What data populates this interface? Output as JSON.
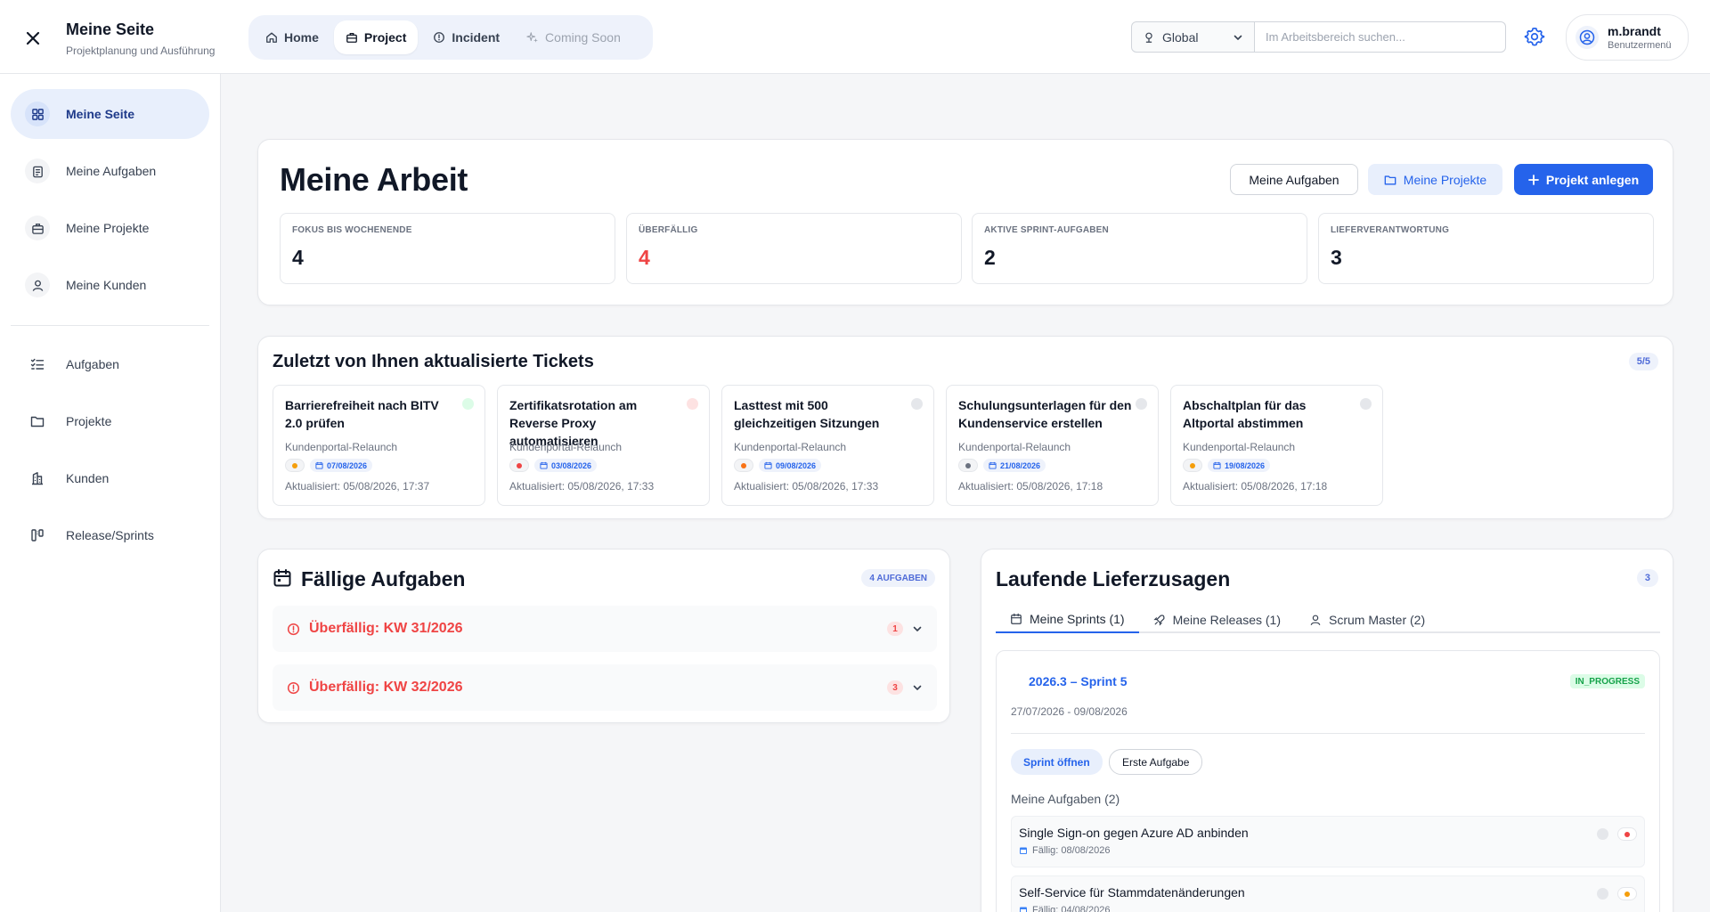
{
  "header": {
    "title": "Meine Seite",
    "subtitle": "Projektplanung und Ausführung",
    "nav": [
      {
        "label": "Home"
      },
      {
        "label": "Project"
      },
      {
        "label": "Incident"
      },
      {
        "label": "Coming Soon"
      }
    ],
    "scope": "Global",
    "search_placeholder": "Im Arbeitsbereich suchen...",
    "user": {
      "name": "m.brandt",
      "caption": "Benutzermenü"
    }
  },
  "sidebar": {
    "primary": [
      {
        "label": "Meine Seite"
      },
      {
        "label": "Meine Aufgaben"
      },
      {
        "label": "Meine Projekte"
      },
      {
        "label": "Meine Kunden"
      }
    ],
    "secondary": [
      {
        "label": "Aufgaben"
      },
      {
        "label": "Projekte"
      },
      {
        "label": "Kunden"
      },
      {
        "label": "Release/Sprints"
      }
    ]
  },
  "my_work": {
    "title": "Meine Arbeit",
    "buttons": {
      "tasks": "Meine Aufgaben",
      "projects": "Meine Projekte",
      "create": "Projekt anlegen"
    },
    "stats": [
      {
        "label": "FOKUS BIS WOCHENENDE",
        "value": "4"
      },
      {
        "label": "ÜBERFÄLLIG",
        "value": "4"
      },
      {
        "label": "AKTIVE SPRINT-AUFGABEN",
        "value": "2"
      },
      {
        "label": "LIEFERVERANTWORTUNG",
        "value": "3"
      }
    ]
  },
  "recent": {
    "title": "Zuletzt von Ihnen aktualisierte Tickets",
    "count": "5/5",
    "tickets": [
      {
        "title": "Barrierefreiheit nach BITV 2.0 prüfen",
        "project": "Kundenportal-Relaunch",
        "date": "07/08/2026",
        "updated": "Aktualisiert: 05/08/2026, 17:37",
        "priority_color": "#f59e0b",
        "status_color": "#dcfce7"
      },
      {
        "title": "Zertifikatsrotation am Reverse Proxy automatisieren",
        "project": "Kundenportal-Relaunch",
        "date": "03/08/2026",
        "updated": "Aktualisiert: 05/08/2026, 17:33",
        "priority_color": "#ef4444",
        "status_color": "#fde2e2"
      },
      {
        "title": "Lasttest mit 500 gleichzeitigen Sitzungen",
        "project": "Kundenportal-Relaunch",
        "date": "09/08/2026",
        "updated": "Aktualisiert: 05/08/2026, 17:33",
        "priority_color": "#f97316",
        "status_color": "#e5e7eb"
      },
      {
        "title": "Schulungsunterlagen für den Kundenservice erstellen",
        "project": "Kundenportal-Relaunch",
        "date": "21/08/2026",
        "updated": "Aktualisiert: 05/08/2026, 17:18",
        "priority_color": "#6b7280",
        "status_color": "#e5e7eb"
      },
      {
        "title": "Abschaltplan für das Altportal abstimmen",
        "project": "Kundenportal-Relaunch",
        "date": "19/08/2026",
        "updated": "Aktualisiert: 05/08/2026, 17:18",
        "priority_color": "#f59e0b",
        "status_color": "#e5e7eb"
      }
    ]
  },
  "due": {
    "title": "Fällige Aufgaben",
    "count": "4 AUFGABEN",
    "groups": [
      {
        "label": "Überfällig: KW 31/2026",
        "count": "1"
      },
      {
        "label": "Überfällig: KW 32/2026",
        "count": "3"
      }
    ]
  },
  "delivery": {
    "title": "Laufende Lieferzusagen",
    "count": "3",
    "tabs": [
      {
        "label": "Meine Sprints (1)"
      },
      {
        "label": "Meine Releases (1)"
      },
      {
        "label": "Scrum Master (2)"
      }
    ],
    "sprint": {
      "name": "2026.3 – Sprint 5",
      "status": "IN_PROGRESS",
      "dates": "27/07/2026 - 09/08/2026",
      "open_label": "Sprint öffnen",
      "first_label": "Erste Aufgabe",
      "tasks_heading": "Meine Aufgaben (2)",
      "tasks": [
        {
          "title": "Single Sign-on gegen Azure AD anbinden",
          "due": "Fällig: 08/08/2026",
          "priority_color": "#ef4444"
        },
        {
          "title": "Self-Service für Stammdatenänderungen",
          "due": "Fällig: 04/08/2026",
          "priority_color": "#f59e0b"
        }
      ]
    }
  },
  "colors": {
    "accent": "#2563eb",
    "danger": "#ef4444",
    "success": "#16a34a"
  }
}
